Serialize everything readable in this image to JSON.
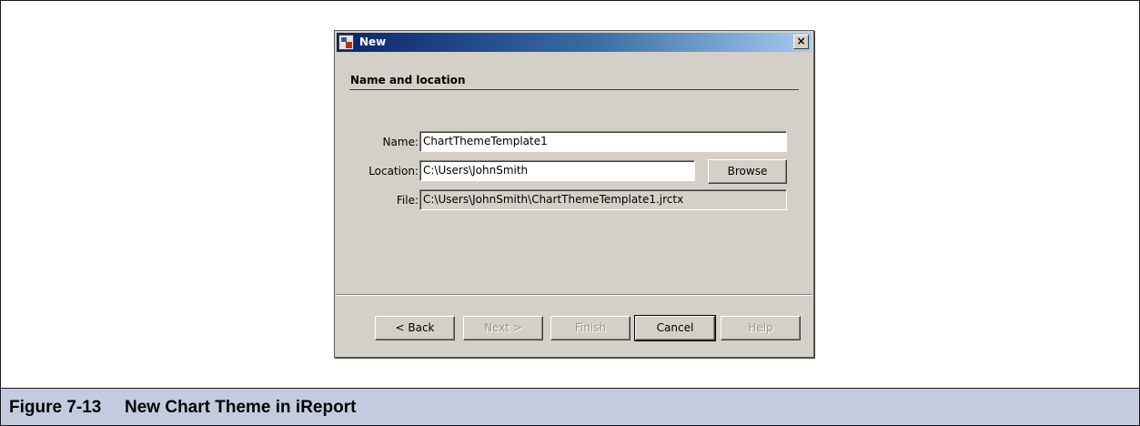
{
  "dialog": {
    "title": "New",
    "close_glyph": "×",
    "section_title": "Name and location",
    "fields": {
      "name_label": "Name:",
      "name_value": "ChartThemeTemplate1",
      "location_label": "Location:",
      "location_value": "C:\\Users\\JohnSmith",
      "file_label": "File:",
      "file_value": "C:\\Users\\JohnSmith\\ChartThemeTemplate1.jrctx"
    },
    "browse_label": "Browse",
    "buttons": {
      "back": "< Back",
      "next": "Next >",
      "finish": "Finish",
      "cancel": "Cancel",
      "help": "Help"
    }
  },
  "caption": {
    "number": "Figure 7-13",
    "title": "New Chart Theme in iReport"
  },
  "colors": {
    "caption_bg": "#c3ccdf",
    "titlebar_start": "#0a246a",
    "titlebar_end": "#a6caf0",
    "dialog_bg": "#d4d0c8"
  }
}
